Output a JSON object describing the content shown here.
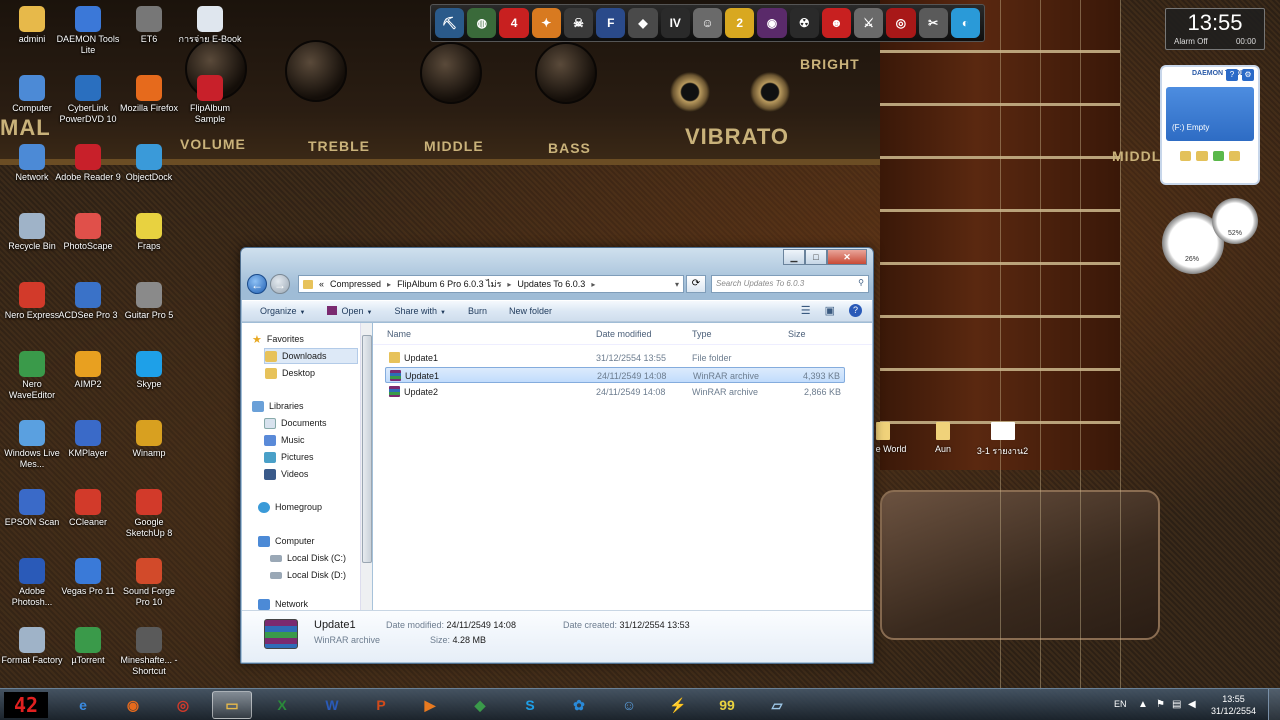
{
  "amp": {
    "labels": [
      "VOLUME",
      "TREBLE",
      "MIDDLE",
      "BASS",
      "VIBRATO",
      "BRIGHT",
      "MIDDL",
      "MAL"
    ]
  },
  "desktop_icons": [
    {
      "label": "admini",
      "icon": "folder-user-icon",
      "color": "#e7b94a"
    },
    {
      "label": "DAEMON Tools Lite",
      "icon": "daemon-tools-icon",
      "color": "#3b78d8"
    },
    {
      "label": "ET6",
      "icon": "et6-icon",
      "color": "#777777"
    },
    {
      "label": "การจ่าย E-Book",
      "icon": "ebook-icon",
      "color": "#dfe6ee"
    },
    {
      "label": "Computer",
      "icon": "computer-icon",
      "color": "#4c8ad6"
    },
    {
      "label": "CyberLink PowerDVD 10",
      "icon": "powerdvd-icon",
      "color": "#2a6fbf"
    },
    {
      "label": "Mozilla Firefox",
      "icon": "firefox-icon",
      "color": "#e66a1c"
    },
    {
      "label": "FlipAlbum Sample",
      "icon": "flipalbum-icon",
      "color": "#c8202a"
    },
    {
      "label": "Network",
      "icon": "network-icon",
      "color": "#4c8ad6"
    },
    {
      "label": "Adobe Reader 9",
      "icon": "adobe-reader-icon",
      "color": "#c8202a"
    },
    {
      "label": "ObjectDock",
      "icon": "objectdock-icon",
      "color": "#3a9ad9"
    },
    {
      "label": "Recycle Bin",
      "icon": "recycle-bin-icon",
      "color": "#9fb3c8"
    },
    {
      "label": "PhotoScape",
      "icon": "photoscape-icon",
      "color": "#e0504a"
    },
    {
      "label": "Fraps",
      "icon": "fraps-icon",
      "color": "#e8d240"
    },
    {
      "label": "Nero Express",
      "icon": "nero-express-icon",
      "color": "#d23a2a"
    },
    {
      "label": "ACDSee Pro 3",
      "icon": "acdsee-icon",
      "color": "#3a72c8"
    },
    {
      "label": "Guitar Pro 5",
      "icon": "guitar-pro-icon",
      "color": "#8a8a8a"
    },
    {
      "label": "Nero WaveEditor",
      "icon": "nero-waveeditor-icon",
      "color": "#3a9a4a"
    },
    {
      "label": "AIMP2",
      "icon": "aimp-icon",
      "color": "#e8a020"
    },
    {
      "label": "Skype",
      "icon": "skype-icon",
      "color": "#1ea0e8"
    },
    {
      "label": "Windows Live Mes...",
      "icon": "windows-live-messenger-icon",
      "color": "#5aa0e0"
    },
    {
      "label": "KMPlayer",
      "icon": "kmplayer-icon",
      "color": "#3a6ac8"
    },
    {
      "label": "Winamp",
      "icon": "winamp-icon",
      "color": "#d8a020"
    },
    {
      "label": "EPSON Scan",
      "icon": "epson-scan-icon",
      "color": "#3a6ac8"
    },
    {
      "label": "CCleaner",
      "icon": "ccleaner-icon",
      "color": "#d23a2a"
    },
    {
      "label": "Google SketchUp 8",
      "icon": "sketchup-icon",
      "color": "#d23a2a"
    },
    {
      "label": "Adobe Photosh...",
      "icon": "photoshop-icon",
      "color": "#2a5ab8"
    },
    {
      "label": "Vegas Pro 11",
      "icon": "vegas-pro-icon",
      "color": "#3a7ad8"
    },
    {
      "label": "Sound Forge Pro 10",
      "icon": "sound-forge-icon",
      "color": "#d24a2a"
    },
    {
      "label": "Format Factory",
      "icon": "format-factory-icon",
      "color": "#9fb3c8"
    },
    {
      "label": "µTorrent",
      "icon": "utorrent-icon",
      "color": "#3a9a4a"
    },
    {
      "label": "Mineshafte... - Shortcut",
      "icon": "mineshafter-icon",
      "color": "#5a5a5a"
    }
  ],
  "right_desktop_files": [
    {
      "label": "e World",
      "icon": "folder-icon"
    },
    {
      "label": "Aun",
      "icon": "folder-icon"
    },
    {
      "label": "3-1 รายงาน2",
      "icon": "document-icon"
    }
  ],
  "top_dock": {
    "items": [
      {
        "icon": "minecraft-icon",
        "glyph": "⛏",
        "color": "#2a5a8a"
      },
      {
        "icon": "globe-icon",
        "glyph": "◍",
        "color": "#3a6a3a"
      },
      {
        "icon": "4d-icon",
        "glyph": "4",
        "color": "#c82020"
      },
      {
        "icon": "ps2-icon",
        "glyph": "✦",
        "color": "#d87a20"
      },
      {
        "icon": "call-of-duty-icon",
        "glyph": "☠",
        "color": "#3a3a3a"
      },
      {
        "icon": "fifa-icon",
        "glyph": "F",
        "color": "#2a4a8a"
      },
      {
        "icon": "cube-icon",
        "glyph": "◆",
        "color": "#4a4a4a"
      },
      {
        "icon": "gta-iv-icon",
        "glyph": "IV",
        "color": "#2a2a2a"
      },
      {
        "icon": "ghost-icon",
        "glyph": "☺",
        "color": "#6a6a6a"
      },
      {
        "icon": "two-icon",
        "glyph": "2",
        "color": "#d8a820"
      },
      {
        "icon": "game-icon",
        "glyph": "◉",
        "color": "#5a2a6a"
      },
      {
        "icon": "black-ops-icon",
        "glyph": "☢",
        "color": "#2a2a2a"
      },
      {
        "icon": "red-skull-icon",
        "glyph": "☻",
        "color": "#c82020"
      },
      {
        "icon": "assassin-icon",
        "glyph": "⚔",
        "color": "#6a6a6a"
      },
      {
        "icon": "red-logo-icon",
        "glyph": "◎",
        "color": "#a81818"
      },
      {
        "icon": "sword-icon",
        "glyph": "✂",
        "color": "#5a5a5a"
      },
      {
        "icon": "swirl-icon",
        "glyph": "◐",
        "color": "#2a9ad8"
      }
    ]
  },
  "clock_gadget": {
    "time": "13:55",
    "label": "Alarm Off",
    "alarm": "00:00"
  },
  "daemon_gadget": {
    "title": "DAEMON TOOLS",
    "drive": "(F:) Empty"
  },
  "gauges": {
    "left": "26%",
    "right": "52%"
  },
  "explorer": {
    "breadcrumb": [
      "«",
      "Compressed",
      "FlipAlbum 6 Pro 6.0.3 ไม่ร",
      "Updates To 6.0.3"
    ],
    "search_placeholder": "Search Updates To 6.0.3",
    "toolbar": {
      "organize": "Organize",
      "open": "Open",
      "share": "Share with",
      "burn": "Burn",
      "new_folder": "New folder"
    },
    "nav": {
      "favorites": "Favorites",
      "downloads": "Downloads",
      "desktop": "Desktop",
      "libraries": "Libraries",
      "documents": "Documents",
      "music": "Music",
      "pictures": "Pictures",
      "videos": "Videos",
      "homegroup": "Homegroup",
      "computer": "Computer",
      "local_c": "Local Disk (C:)",
      "local_d": "Local Disk (D:)",
      "network": "Network"
    },
    "columns": {
      "name": "Name",
      "date": "Date modified",
      "type": "Type",
      "size": "Size"
    },
    "files": [
      {
        "name": "Update1",
        "date": "31/12/2554 13:55",
        "type": "File folder",
        "size": ""
      },
      {
        "name": "Update1",
        "date": "24/11/2549 14:08",
        "type": "WinRAR archive",
        "size": "4,393 KB"
      },
      {
        "name": "Update2",
        "date": "24/11/2549 14:08",
        "type": "WinRAR archive",
        "size": "2,866 KB"
      }
    ],
    "details": {
      "name": "Update1",
      "type": "WinRAR archive",
      "date_modified_label": "Date modified:",
      "date_modified": "24/11/2549 14:08",
      "size_label": "Size:",
      "size": "4.28 MB",
      "date_created_label": "Date created:",
      "date_created": "31/12/2554 13:53"
    }
  },
  "taskbar": {
    "start_text": "42",
    "items": [
      {
        "icon": "internet-explorer-icon",
        "glyph": "e",
        "color": "#3a8ae0"
      },
      {
        "icon": "firefox-icon",
        "glyph": "◉",
        "color": "#e66a1c"
      },
      {
        "icon": "chrome-icon",
        "glyph": "◎",
        "color": "#d23a2a"
      },
      {
        "icon": "explorer-icon",
        "glyph": "▭",
        "color": "#e7b94a"
      },
      {
        "icon": "excel-icon",
        "glyph": "X",
        "color": "#2a8a3a"
      },
      {
        "icon": "word-icon",
        "glyph": "W",
        "color": "#2a5ab8"
      },
      {
        "icon": "powerpoint-icon",
        "glyph": "P",
        "color": "#d24a1a"
      },
      {
        "icon": "media-player-icon",
        "glyph": "▶",
        "color": "#e87a20"
      },
      {
        "icon": "network-map-icon",
        "glyph": "◆",
        "color": "#3a9a4a"
      },
      {
        "icon": "skype-icon",
        "glyph": "S",
        "color": "#1ea0e8"
      },
      {
        "icon": "connect-icon",
        "glyph": "✿",
        "color": "#2a8ad8"
      },
      {
        "icon": "messenger-icon",
        "glyph": "☺",
        "color": "#5aa0e0"
      },
      {
        "icon": "winamp-icon",
        "glyph": "⚡",
        "color": "#d8a020"
      },
      {
        "icon": "fraps-icon",
        "glyph": "99",
        "color": "#e8d240"
      },
      {
        "icon": "window-icon",
        "glyph": "▱",
        "color": "#9fc8e8"
      }
    ],
    "lang": "EN",
    "time": "13:55",
    "date": "31/12/2554"
  }
}
